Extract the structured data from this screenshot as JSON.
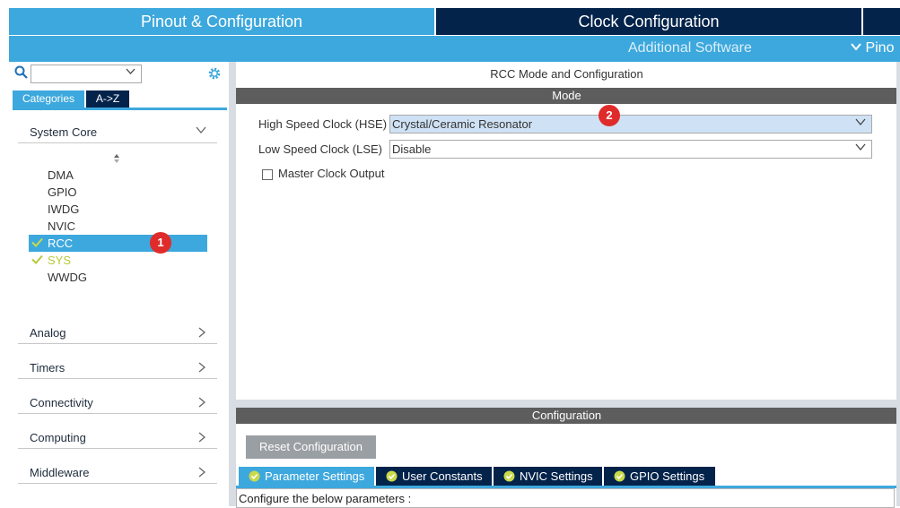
{
  "tabs": {
    "pinout": "Pinout & Configuration",
    "clock": "Clock Configuration",
    "additional_software": "Additional Software",
    "pinout_short": "Pino"
  },
  "sidebar": {
    "search_value": "",
    "categories_tab": "Categories",
    "az_tab": "A->Z",
    "system_core": {
      "label": "System Core",
      "items": [
        "DMA",
        "GPIO",
        "IWDG",
        "NVIC",
        "RCC",
        "SYS",
        "WWDG"
      ],
      "selected": "RCC"
    },
    "sections": [
      "Analog",
      "Timers",
      "Connectivity",
      "Computing",
      "Middleware"
    ]
  },
  "annotations": {
    "badge1": "1",
    "badge2": "2"
  },
  "main": {
    "title": "RCC Mode and Configuration",
    "mode_header": "Mode",
    "hse_label": "High Speed Clock (HSE)",
    "hse_value": "Crystal/Ceramic Resonator",
    "lse_label": "Low Speed Clock (LSE)",
    "lse_value": "Disable",
    "mco_label": "Master Clock Output",
    "config_header": "Configuration",
    "reset_button": "Reset Configuration",
    "config_tabs": [
      "Parameter Settings",
      "User Constants",
      "NVIC Settings",
      "GPIO Settings"
    ],
    "params_caption": "Configure the below parameters :"
  },
  "colors": {
    "accent_blue": "#3da8dd",
    "navy": "#03234b",
    "check_green": "#b7c93a",
    "badge_red": "#e02b2b"
  }
}
